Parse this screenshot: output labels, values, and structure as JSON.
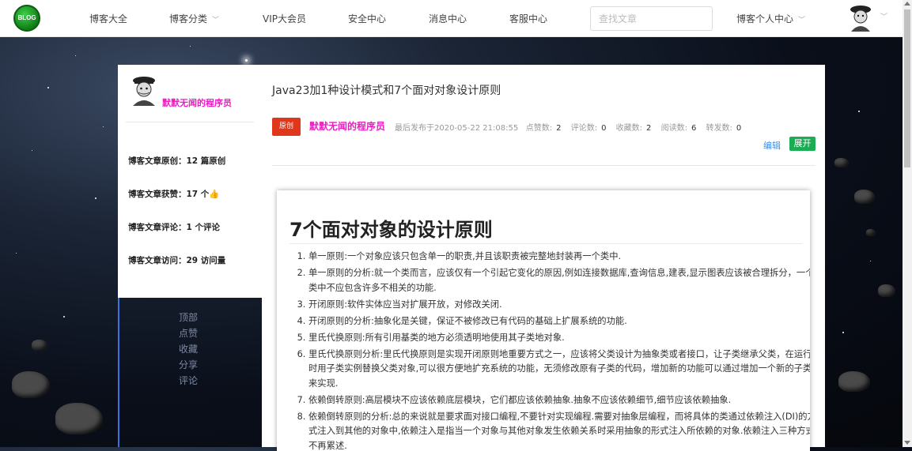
{
  "nav": {
    "logo_text": "BLOG",
    "items": [
      {
        "label": "博客大全",
        "has_dropdown": false
      },
      {
        "label": "博客分类",
        "has_dropdown": true
      },
      {
        "label": "VIP大会员",
        "has_dropdown": false
      },
      {
        "label": "安全中心",
        "has_dropdown": false
      },
      {
        "label": "消息中心",
        "has_dropdown": false
      },
      {
        "label": "客服中心",
        "has_dropdown": false
      }
    ],
    "search_placeholder": "查找文章",
    "personal_center": "博客个人中心"
  },
  "profile": {
    "name": "默默无闻的程序员",
    "stats": [
      "博客文章原创：12 篇原创",
      "博客文章获赞：17 个👍",
      "博客文章评论：1 个评论",
      "博客文章访问：29 访问量"
    ],
    "side_links": [
      "顶部",
      "点赞",
      "收藏",
      "分享",
      "评论"
    ]
  },
  "article": {
    "title": "Java23加1种设计模式和7个面对对象设计原则",
    "badge": "原创",
    "author": "默默无闻的程序员",
    "published": "最后发布于2020-05-22 21:08:55",
    "likes_label": "点赞数:",
    "likes": "2",
    "comments_label": "评论数:",
    "comments": "0",
    "favorites_label": "收藏数:",
    "favorites": "2",
    "reads_label": "阅读数:",
    "reads": "6",
    "shares_label": "转发数:",
    "shares": "0",
    "edit_label": "编辑",
    "expand_label": "展开"
  },
  "content": {
    "heading": "7个面对对象的设计原则",
    "rules": [
      "单一原则:一个对象应该只包含单一的职责,并且该职责被完整地封装再一个类中.",
      "单一原则的分析:就一个类而言，应该仅有一个引起它变化的原因,例如连接数据库,查询信息,建表,显示图表应该被合理拆分，一个类中不应包含许多不相关的功能.",
      "开闭原则:软件实体应当对扩展开放，对修改关闭.",
      "开闭原则的分析:抽象化是关键，保证不被修改已有代码的基础上扩展系统的功能.",
      "里氏代换原则:所有引用基类的地方必须透明地使用其子类地对象.",
      "里氏代换原则分析:里氏代换原则是实现开闭原则地重要方式之一，应该将父类设计为抽象类或者接口，让子类继承父类，在运行时用子类实例替换父类对象,可以很方便地扩充系统的功能，无须修改原有子类的代码，增加新的功能可以通过增加一个新的子类来实现.",
      "依赖倒转原则:高层模块不应该依赖底层模块，它们都应该依赖抽象.抽象不应该依赖细节,细节应该依赖抽象.",
      "依赖倒转原则的分析:总的来说就是要求面对接口编程,不要针对实现编程.需要对抽象层编程，而将具体的类通过依赖注入(DI)的方式注入到其他的对象中,依赖注入是指当一个对象与其他对象发生依赖关系时采用抽象的形式注入所依赖的对象.依赖注入三种方式不再累述."
    ]
  },
  "colors": {
    "author_pink": "#e91ec1",
    "badge_red": "#e0361b",
    "expand_green": "#1aad53",
    "edit_blue": "#3a8ee6"
  }
}
